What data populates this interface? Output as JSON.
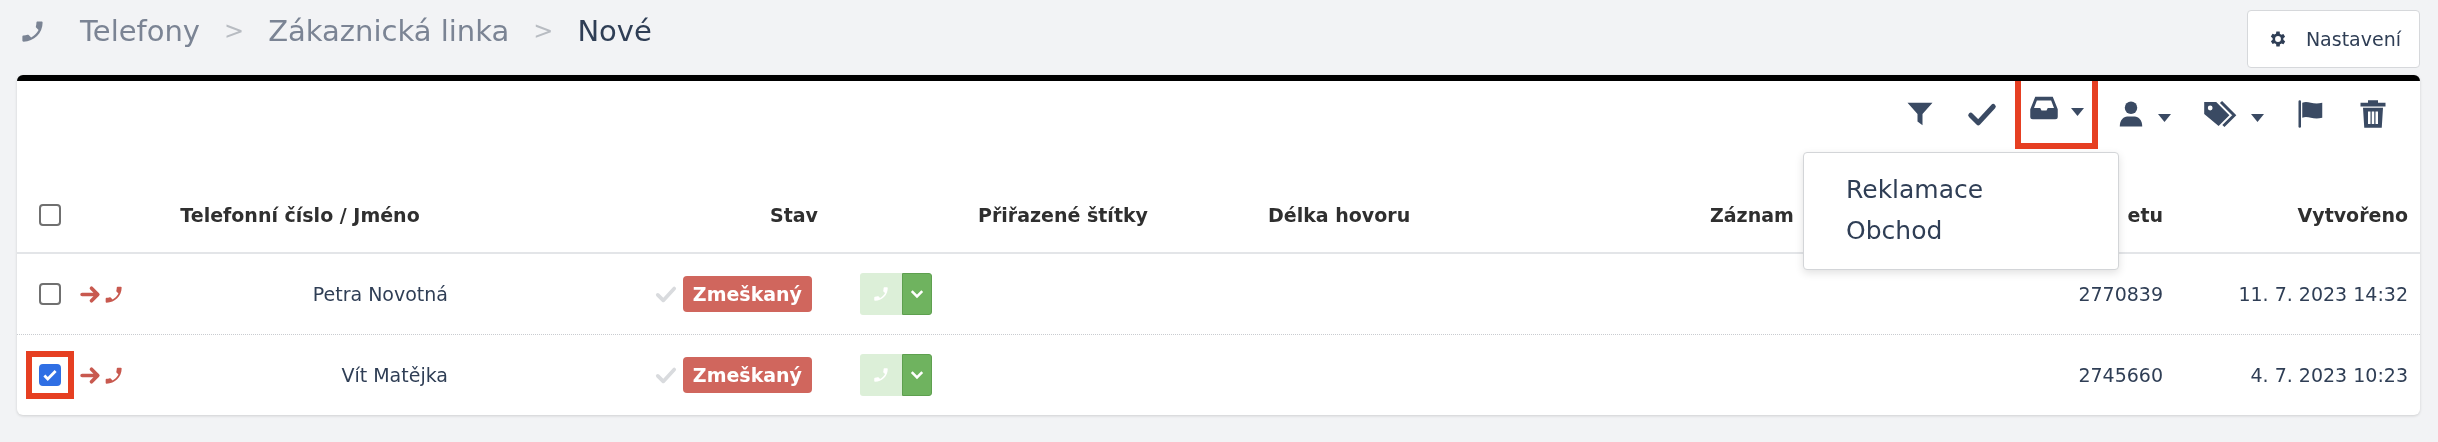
{
  "breadcrumb": {
    "items": [
      "Telefony",
      "Zákaznická linka",
      "Nové"
    ],
    "separators": [
      ">",
      ">"
    ]
  },
  "settings_button": {
    "label": "Nastavení"
  },
  "toolbar": [
    {
      "kind": "filter",
      "dropdown": false,
      "highlighted": false
    },
    {
      "kind": "check",
      "dropdown": false,
      "highlighted": false
    },
    {
      "kind": "inbox",
      "dropdown": true,
      "highlighted": true
    },
    {
      "kind": "user",
      "dropdown": true,
      "highlighted": false
    },
    {
      "kind": "tags",
      "dropdown": true,
      "highlighted": false
    },
    {
      "kind": "flag",
      "dropdown": false,
      "highlighted": false
    },
    {
      "kind": "trash",
      "dropdown": false,
      "highlighted": false
    }
  ],
  "dropdown_menu": {
    "items": [
      "Reklamace",
      "Obchod"
    ]
  },
  "table": {
    "header_checkbox": {
      "checked": false
    },
    "columns": [
      "Telefonní číslo / Jméno",
      "Stav",
      "Přiřazené štítky",
      "Délka hovoru",
      "Záznam",
      "etu",
      "Vytvořeno"
    ],
    "rows": [
      {
        "selected": false,
        "highlighted": false,
        "name": "Petra Novotná",
        "status": "Zmeškaný",
        "column_6": "2770839",
        "created": "11. 7. 2023 14:32"
      },
      {
        "selected": true,
        "highlighted": true,
        "name": "Vít Matějka",
        "status": "Zmeškaný",
        "column_6": "2745660",
        "created": "4. 7. 2023 10:23"
      }
    ]
  }
}
